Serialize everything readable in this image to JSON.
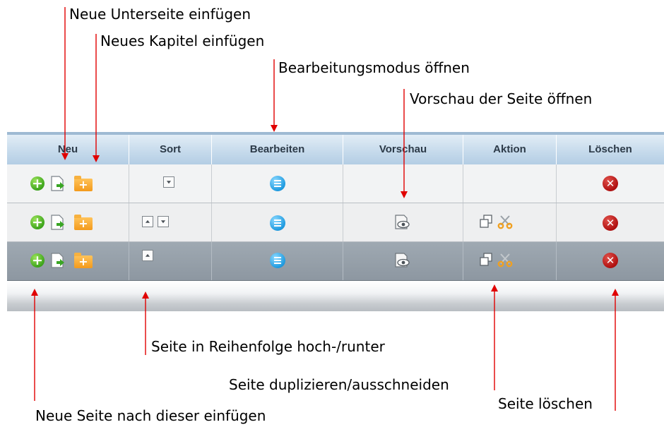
{
  "callouts": {
    "new_subpage": "Neue Unterseite einfügen",
    "new_chapter": "Neues Kapitel einfügen",
    "edit_mode": "Bearbeitungsmodus öffnen",
    "preview": "Vorschau der Seite öffnen",
    "sort": "Seite in Reihenfolge hoch-/runter",
    "duplicate_cut": "Seite duplizieren/ausschneiden",
    "new_page_after": "Neue Seite nach dieser einfügen",
    "delete": "Seite löschen"
  },
  "table": {
    "headers": [
      "Neu",
      "Sort",
      "Bearbeiten",
      "Vorschau",
      "Aktion",
      "Löschen"
    ],
    "rows": [
      {
        "sort_buttons": [
          "down"
        ],
        "has_preview": false,
        "has_actions": false
      },
      {
        "sort_buttons": [
          "up",
          "down"
        ],
        "has_preview": true,
        "has_actions": true
      },
      {
        "sort_buttons": [
          "up"
        ],
        "has_preview": true,
        "has_actions": true
      }
    ]
  },
  "icons": {
    "new_page": "plus-circle-icon",
    "new_subpage": "document-arrow-icon",
    "new_chapter": "folder-plus-icon",
    "sort_up": "triangle-up-icon",
    "sort_down": "triangle-down-icon",
    "edit": "list-circle-icon",
    "preview": "eye-document-icon",
    "duplicate": "copy-icon",
    "cut": "scissors-icon",
    "delete": "x-circle-icon"
  },
  "colors": {
    "annotation_arrow": "#e00000",
    "header_bg": "#c7dbec",
    "selected_row_bg": "#97a1ab",
    "add_green": "#3ea51c",
    "edit_blue": "#1f9be0",
    "delete_red": "#b01010",
    "folder_orange": "#f39a1c"
  }
}
